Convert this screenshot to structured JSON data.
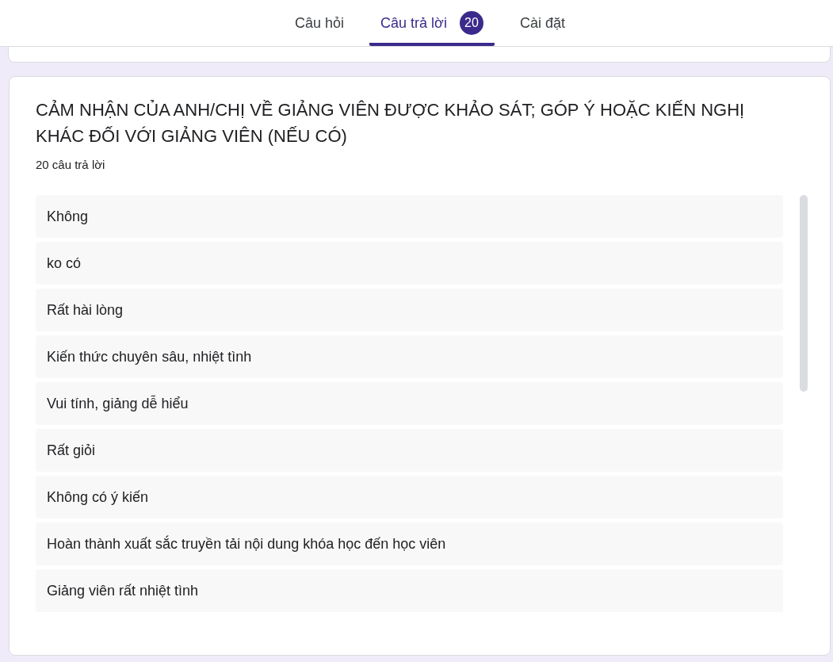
{
  "tabs": [
    {
      "label": "Câu hỏi",
      "selected": false
    },
    {
      "label": "Câu trả lời",
      "selected": true,
      "badge": "20"
    },
    {
      "label": "Cài đặt",
      "selected": false
    }
  ],
  "question": {
    "title": "CẢM NHẬN CỦA ANH/CHỊ VỀ GIẢNG VIÊN ĐƯỢC KHẢO SÁT; GÓP Ý HOẶC KIẾN NGHỊ KHÁC ĐỐI VỚI GIẢNG VIÊN (NẾU CÓ)",
    "response_count": "20 câu trả lời",
    "responses": [
      "Không",
      "ko có",
      "Rất hài lòng",
      "Kiến thức chuyên sâu, nhiệt tình",
      "Vui tính, giảng dễ hiểu",
      "Rất giỏi",
      "Không có ý kiến",
      "Hoàn thành xuất sắc truyền tải nội dung khóa học đến học viên",
      "Giảng viên rất nhiệt tình"
    ]
  }
}
